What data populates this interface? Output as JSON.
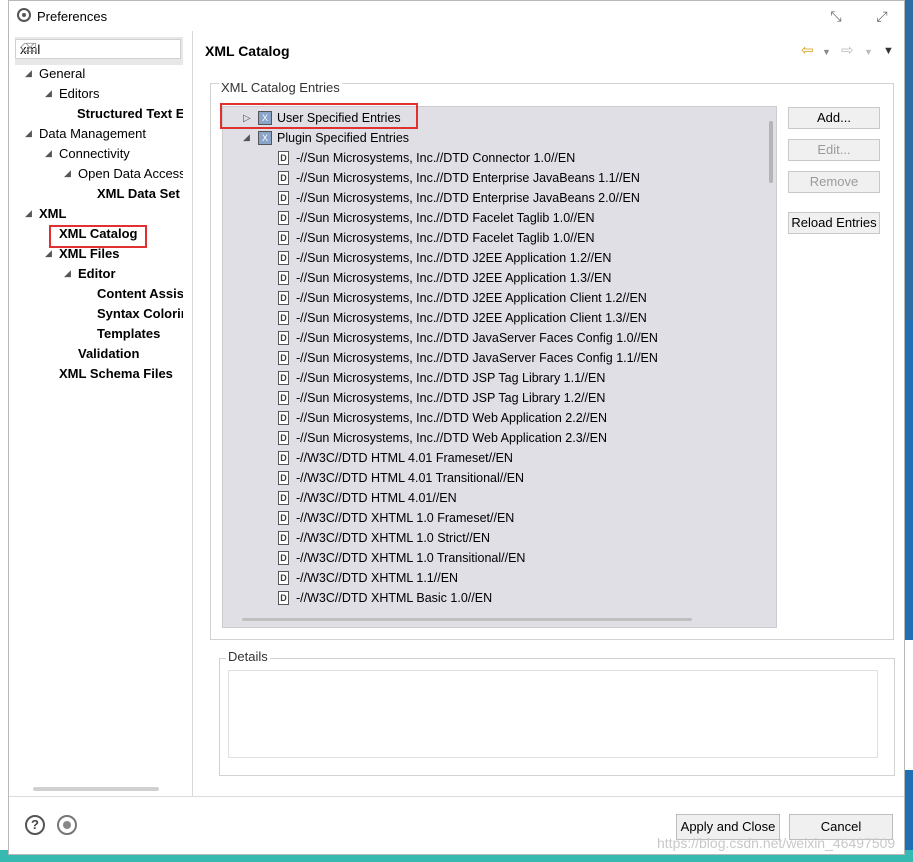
{
  "window": {
    "title": "Preferences"
  },
  "search": {
    "value": "xml"
  },
  "tree": [
    {
      "label": "General"
    },
    {
      "label": "Editors"
    },
    {
      "label": "Structured Text E"
    },
    {
      "label": "Data Management"
    },
    {
      "label": "Connectivity"
    },
    {
      "label": "Open Data Access"
    },
    {
      "label": "XML Data Set"
    },
    {
      "label": "XML"
    },
    {
      "label": "XML Catalog"
    },
    {
      "label": "XML Files"
    },
    {
      "label": "Editor"
    },
    {
      "label": "Content Assis"
    },
    {
      "label": "Syntax Colorin"
    },
    {
      "label": "Templates"
    },
    {
      "label": "Validation"
    },
    {
      "label": "XML Schema Files"
    }
  ],
  "page": {
    "title": "XML Catalog"
  },
  "catalog": {
    "group_label": "XML Catalog Entries",
    "categories": [
      "User Specified Entries",
      "Plugin Specified Entries"
    ],
    "entries": [
      "-//Sun Microsystems, Inc.//DTD Connector 1.0//EN",
      "-//Sun Microsystems, Inc.//DTD Enterprise JavaBeans 1.1//EN",
      "-//Sun Microsystems, Inc.//DTD Enterprise JavaBeans 2.0//EN",
      "-//Sun Microsystems, Inc.//DTD Facelet Taglib 1.0//EN",
      "-//Sun Microsystems, Inc.//DTD Facelet Taglib 1.0//EN",
      "-//Sun Microsystems, Inc.//DTD J2EE Application 1.2//EN",
      "-//Sun Microsystems, Inc.//DTD J2EE Application 1.3//EN",
      "-//Sun Microsystems, Inc.//DTD J2EE Application Client 1.2//EN",
      "-//Sun Microsystems, Inc.//DTD J2EE Application Client 1.3//EN",
      "-//Sun Microsystems, Inc.//DTD JavaServer Faces Config 1.0//EN",
      "-//Sun Microsystems, Inc.//DTD JavaServer Faces Config 1.1//EN",
      "-//Sun Microsystems, Inc.//DTD JSP Tag Library 1.1//EN",
      "-//Sun Microsystems, Inc.//DTD JSP Tag Library 1.2//EN",
      "-//Sun Microsystems, Inc.//DTD Web Application 2.2//EN",
      "-//Sun Microsystems, Inc.//DTD Web Application 2.3//EN",
      "-//W3C//DTD HTML 4.01 Frameset//EN",
      "-//W3C//DTD HTML 4.01 Transitional//EN",
      "-//W3C//DTD HTML 4.01//EN",
      "-//W3C//DTD XHTML 1.0 Frameset//EN",
      "-//W3C//DTD XHTML 1.0 Strict//EN",
      "-//W3C//DTD XHTML 1.0 Transitional//EN",
      "-//W3C//DTD XHTML 1.1//EN",
      "-//W3C//DTD XHTML Basic 1.0//EN"
    ],
    "entry_icon_letter": "D",
    "buttons": {
      "add": "Add...",
      "edit": "Edit...",
      "remove": "Remove",
      "reload": "Reload Entries"
    }
  },
  "details": {
    "label": "Details"
  },
  "footer": {
    "apply_close": "Apply and Close",
    "cancel": "Cancel",
    "help_symbol": "?"
  },
  "watermark": "https://blog.csdn.net/weixin_46497509",
  "colors": {
    "highlight_box": "#e0302f",
    "list_background": "#dfdfe5"
  }
}
